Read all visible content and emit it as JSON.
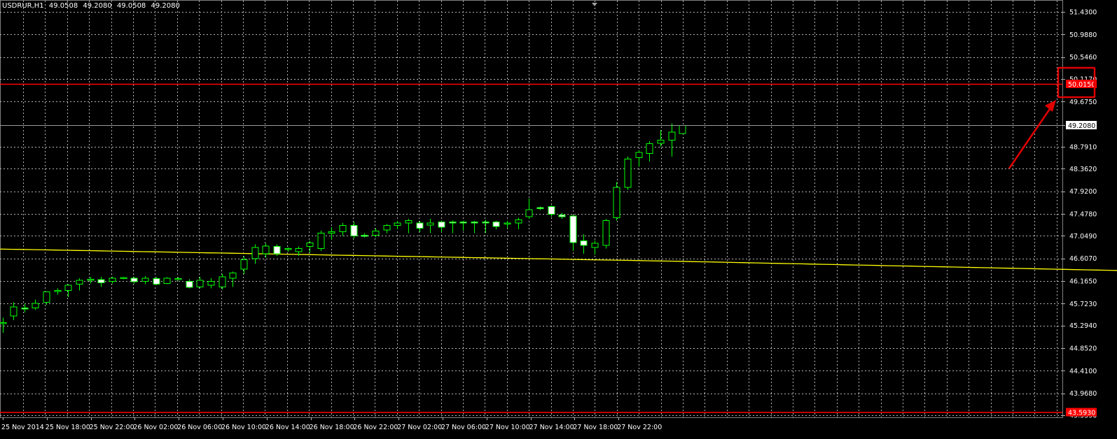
{
  "header": {
    "symbol_timeframe": "USDRUR,H1",
    "open": "49.0508",
    "high": "49.2080",
    "low": "49.0508",
    "close": "49.2080"
  },
  "colors": {
    "background": "#000000",
    "grid": "#b4b4b4",
    "bull_candle": "#00ff00",
    "bear_candle_body": "#ffffff",
    "moving_average": "#ffff00",
    "level_line": "#ff0000",
    "annotation": "#e00000",
    "axis_text": "#ffffff"
  },
  "chart_data": {
    "type": "candlestick",
    "ylim": [
      43.5,
      51.6
    ],
    "y_ticks": [
      "51.4300",
      "50.9880",
      "50.5460",
      "50.1170",
      "49.6750",
      "49.2080",
      "48.7910",
      "48.3620",
      "47.9200",
      "47.4780",
      "47.0490",
      "46.6070",
      "46.1650",
      "45.7230",
      "45.2940",
      "44.8520",
      "44.4100",
      "43.9680",
      "43.5390"
    ],
    "x_labels": [
      "25 Nov 2014",
      "25 Nov 18:00",
      "25 Nov 22:00",
      "26 Nov 02:00",
      "26 Nov 06:00",
      "26 Nov 10:00",
      "26 Nov 14:00",
      "26 Nov 18:00",
      "26 Nov 22:00",
      "27 Nov 02:00",
      "27 Nov 06:00",
      "27 Nov 10:00",
      "27 Nov 14:00",
      "27 Nov 18:00",
      "27 Nov 22:00"
    ],
    "candles": [
      {
        "o": 45.35,
        "h": 45.45,
        "l": 45.15,
        "c": 45.35
      },
      {
        "o": 45.48,
        "h": 45.75,
        "l": 45.4,
        "c": 45.66
      },
      {
        "o": 45.64,
        "h": 45.72,
        "l": 45.55,
        "c": 45.62
      },
      {
        "o": 45.64,
        "h": 45.8,
        "l": 45.6,
        "c": 45.73
      },
      {
        "o": 45.75,
        "h": 45.95,
        "l": 45.7,
        "c": 45.95
      },
      {
        "o": 45.96,
        "h": 46.02,
        "l": 45.9,
        "c": 45.98
      },
      {
        "o": 45.98,
        "h": 46.1,
        "l": 45.85,
        "c": 46.08
      },
      {
        "o": 46.1,
        "h": 46.22,
        "l": 45.98,
        "c": 46.18
      },
      {
        "o": 46.18,
        "h": 46.25,
        "l": 46.12,
        "c": 46.2
      },
      {
        "o": 46.19,
        "h": 46.25,
        "l": 46.05,
        "c": 46.13
      },
      {
        "o": 46.16,
        "h": 46.25,
        "l": 46.12,
        "c": 46.22
      },
      {
        "o": 46.22,
        "h": 46.25,
        "l": 46.2,
        "c": 46.23
      },
      {
        "o": 46.22,
        "h": 46.25,
        "l": 46.12,
        "c": 46.15
      },
      {
        "o": 46.16,
        "h": 46.26,
        "l": 46.1,
        "c": 46.22
      },
      {
        "o": 46.21,
        "h": 46.25,
        "l": 46.08,
        "c": 46.1
      },
      {
        "o": 46.12,
        "h": 46.24,
        "l": 46.1,
        "c": 46.22
      },
      {
        "o": 46.21,
        "h": 46.24,
        "l": 46.18,
        "c": 46.21
      },
      {
        "o": 46.16,
        "h": 46.2,
        "l": 46.02,
        "c": 46.04
      },
      {
        "o": 46.05,
        "h": 46.25,
        "l": 46.02,
        "c": 46.18
      },
      {
        "o": 46.08,
        "h": 46.22,
        "l": 46.02,
        "c": 46.16
      },
      {
        "o": 46.05,
        "h": 46.3,
        "l": 46.0,
        "c": 46.25
      },
      {
        "o": 46.22,
        "h": 46.35,
        "l": 46.05,
        "c": 46.32
      },
      {
        "o": 46.4,
        "h": 46.65,
        "l": 46.3,
        "c": 46.58
      },
      {
        "o": 46.6,
        "h": 46.88,
        "l": 46.5,
        "c": 46.82
      },
      {
        "o": 46.7,
        "h": 46.9,
        "l": 46.62,
        "c": 46.85
      },
      {
        "o": 46.84,
        "h": 46.88,
        "l": 46.66,
        "c": 46.7
      },
      {
        "o": 46.78,
        "h": 46.82,
        "l": 46.74,
        "c": 46.8
      },
      {
        "o": 46.74,
        "h": 46.84,
        "l": 46.66,
        "c": 46.8
      },
      {
        "o": 46.84,
        "h": 46.95,
        "l": 46.72,
        "c": 46.91
      },
      {
        "o": 46.8,
        "h": 47.15,
        "l": 46.75,
        "c": 47.1
      },
      {
        "o": 47.1,
        "h": 47.22,
        "l": 46.98,
        "c": 47.13
      },
      {
        "o": 47.13,
        "h": 47.3,
        "l": 47.05,
        "c": 47.25
      },
      {
        "o": 47.25,
        "h": 47.32,
        "l": 47.0,
        "c": 47.05
      },
      {
        "o": 47.06,
        "h": 47.1,
        "l": 47.02,
        "c": 47.04
      },
      {
        "o": 47.06,
        "h": 47.2,
        "l": 47.02,
        "c": 47.14
      },
      {
        "o": 47.16,
        "h": 47.28,
        "l": 47.1,
        "c": 47.25
      },
      {
        "o": 47.25,
        "h": 47.34,
        "l": 47.18,
        "c": 47.3
      },
      {
        "o": 47.3,
        "h": 47.38,
        "l": 47.1,
        "c": 47.35
      },
      {
        "o": 47.3,
        "h": 47.34,
        "l": 47.12,
        "c": 47.2
      },
      {
        "o": 47.26,
        "h": 47.38,
        "l": 47.1,
        "c": 47.3
      },
      {
        "o": 47.32,
        "h": 47.35,
        "l": 47.12,
        "c": 47.22
      },
      {
        "o": 47.32,
        "h": 47.35,
        "l": 47.1,
        "c": 47.3
      },
      {
        "o": 47.32,
        "h": 47.34,
        "l": 47.15,
        "c": 47.3
      },
      {
        "o": 47.32,
        "h": 47.34,
        "l": 47.1,
        "c": 47.31
      },
      {
        "o": 47.32,
        "h": 47.36,
        "l": 47.1,
        "c": 47.3
      },
      {
        "o": 47.32,
        "h": 47.34,
        "l": 47.18,
        "c": 47.23
      },
      {
        "o": 47.28,
        "h": 47.34,
        "l": 47.2,
        "c": 47.3
      },
      {
        "o": 47.3,
        "h": 47.4,
        "l": 47.18,
        "c": 47.36
      },
      {
        "o": 47.42,
        "h": 47.78,
        "l": 47.38,
        "c": 47.56
      },
      {
        "o": 47.6,
        "h": 47.62,
        "l": 47.55,
        "c": 47.58
      },
      {
        "o": 47.62,
        "h": 47.64,
        "l": 47.42,
        "c": 47.47
      },
      {
        "o": 47.46,
        "h": 47.5,
        "l": 47.38,
        "c": 47.42
      },
      {
        "o": 47.44,
        "h": 47.46,
        "l": 46.75,
        "c": 46.92
      },
      {
        "o": 46.95,
        "h": 47.08,
        "l": 46.7,
        "c": 46.86
      },
      {
        "o": 46.82,
        "h": 46.96,
        "l": 46.68,
        "c": 46.9
      },
      {
        "o": 46.86,
        "h": 47.38,
        "l": 46.8,
        "c": 47.35
      },
      {
        "o": 47.4,
        "h": 48.1,
        "l": 47.35,
        "c": 48.0
      },
      {
        "o": 48.0,
        "h": 48.6,
        "l": 47.95,
        "c": 48.55
      },
      {
        "o": 48.58,
        "h": 48.72,
        "l": 48.4,
        "c": 48.68
      },
      {
        "o": 48.66,
        "h": 48.9,
        "l": 48.5,
        "c": 48.85
      },
      {
        "o": 48.86,
        "h": 49.12,
        "l": 48.8,
        "c": 48.92
      },
      {
        "o": 48.92,
        "h": 49.25,
        "l": 48.6,
        "c": 49.08
      },
      {
        "o": 49.05,
        "h": 49.21,
        "l": 49.05,
        "c": 49.21
      }
    ],
    "moving_average": {
      "type": "line",
      "x": [
        0,
        62,
        151
      ],
      "y": [
        46.79,
        46.55,
        46.15
      ]
    },
    "horizontal_levels": {
      "upper_level": "50.0150",
      "lower_level": "43.5930",
      "current_price": "49.2080"
    }
  }
}
